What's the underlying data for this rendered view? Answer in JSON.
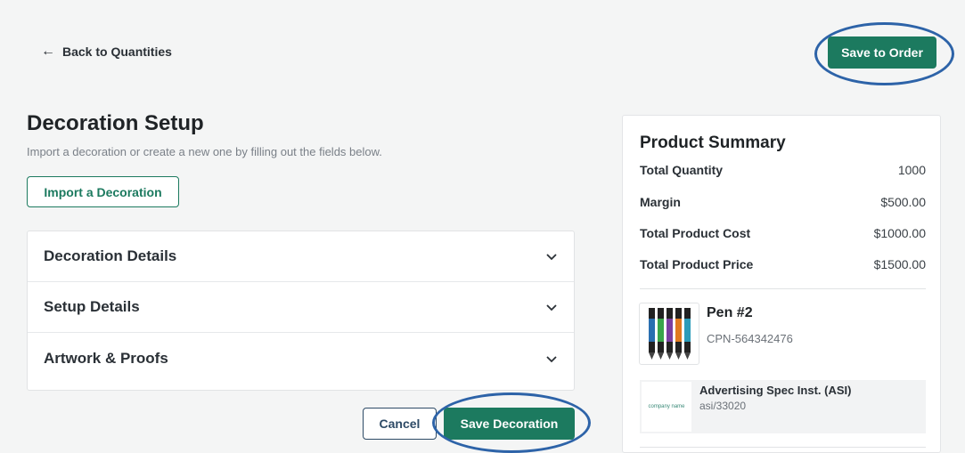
{
  "nav": {
    "back_label": "Back to Quantities"
  },
  "header": {
    "save_order_label": "Save to Order"
  },
  "setup": {
    "title": "Decoration Setup",
    "subtitle": "Import a decoration or create a new one by filling out the fields below.",
    "import_label": "Import a Decoration",
    "sections": [
      {
        "label": "Decoration Details"
      },
      {
        "label": "Setup Details"
      },
      {
        "label": "Artwork & Proofs"
      }
    ],
    "cancel_label": "Cancel",
    "save_label": "Save Decoration"
  },
  "summary": {
    "title": "Product Summary",
    "rows": [
      {
        "label": "Total Quantity",
        "value": "1000"
      },
      {
        "label": "Margin",
        "value": "$500.00"
      },
      {
        "label": "Total Product Cost",
        "value": "$1000.00"
      },
      {
        "label": "Total Product Price",
        "value": "$1500.00"
      }
    ],
    "product": {
      "name": "Pen #2",
      "code": "CPN-564342476"
    },
    "supplier": {
      "name": "Advertising Spec Inst. (ASI)",
      "id": "asi/33020",
      "logo_text": "company name"
    }
  },
  "colors": {
    "primary": "#1c7a5f",
    "highlight": "#2d63a8",
    "cancel_border": "#2d4a66",
    "pen_colors": [
      "#2a6fb0",
      "#3aa54a",
      "#7a3fa0",
      "#e07a1f",
      "#2b9bb8"
    ]
  },
  "icons": {
    "back": "arrow-left-icon",
    "expand": "chevron-down-icon"
  }
}
